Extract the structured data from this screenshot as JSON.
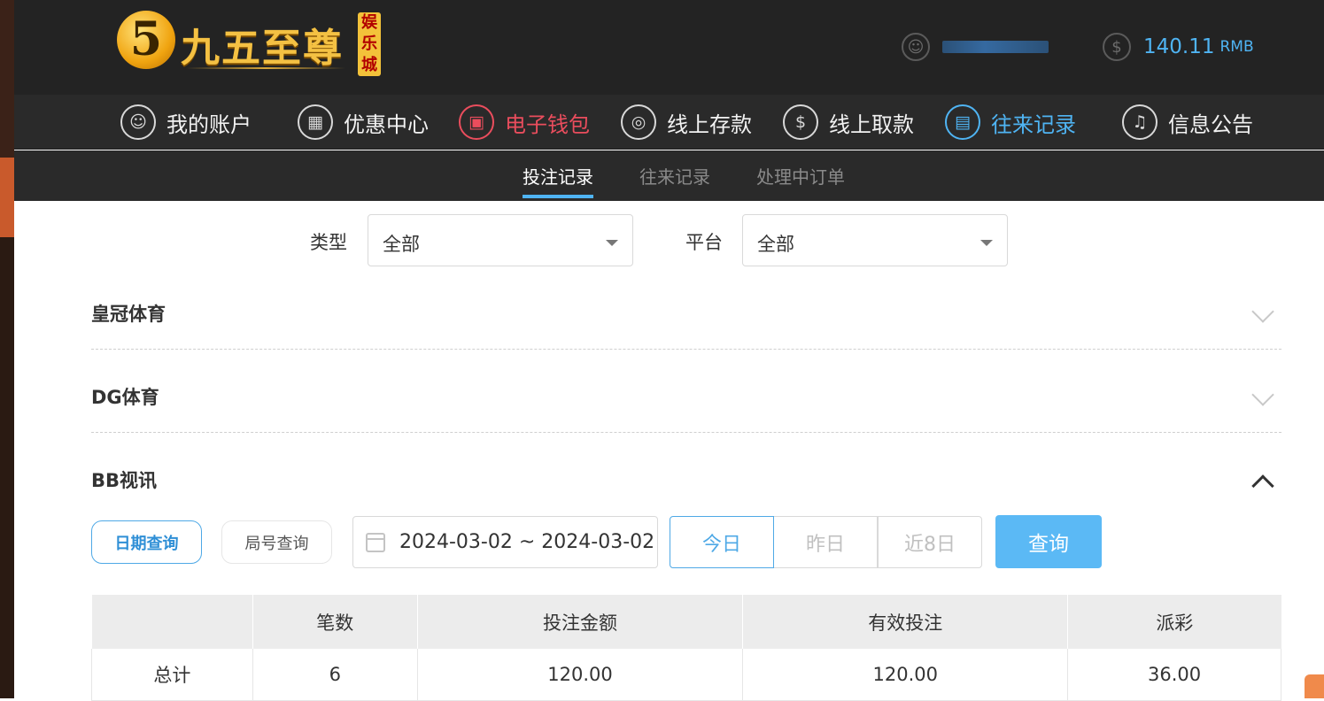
{
  "brand": {
    "logo_glyph": "5",
    "name": "九五至尊",
    "badge": "娱乐城",
    "colors": {
      "gold": "#f4c143",
      "accent": "#4fb4f3",
      "wallet": "#ea4d5d"
    }
  },
  "header": {
    "username": "",
    "balance": "140.11",
    "currency": "RMB"
  },
  "nav": [
    {
      "label": "我的账户",
      "icon": "user-icon",
      "glyph": "☺"
    },
    {
      "label": "优惠中心",
      "icon": "gift-icon",
      "glyph": "▦"
    },
    {
      "label": "电子钱包",
      "icon": "wallet-icon",
      "glyph": "▣"
    },
    {
      "label": "线上存款",
      "icon": "deposit-icon",
      "glyph": "◎"
    },
    {
      "label": "线上取款",
      "icon": "withdraw-icon",
      "glyph": "$"
    },
    {
      "label": "往来记录",
      "icon": "records-icon",
      "glyph": "▤"
    },
    {
      "label": "信息公告",
      "icon": "bell-icon",
      "glyph": "♫"
    }
  ],
  "subnav": [
    "投注记录",
    "往来记录",
    "处理中订单"
  ],
  "filters": {
    "type_label": "类型",
    "type_value": "全部",
    "platform_label": "平台",
    "platform_value": "全部"
  },
  "accordions": [
    "皇冠体育",
    "DG体育",
    "BB视讯"
  ],
  "query": {
    "by_date": "日期查询",
    "by_round": "局号查询",
    "date_range": "2024-03-02 ~ 2024-03-02",
    "today": "今日",
    "yesterday": "昨日",
    "last8": "近8日",
    "submit": "查询"
  },
  "table": {
    "headers": [
      "",
      "笔数",
      "投注金额",
      "有效投注",
      "派彩"
    ],
    "rows": [
      [
        "总计",
        "6",
        "120.00",
        "120.00",
        "36.00"
      ]
    ]
  }
}
